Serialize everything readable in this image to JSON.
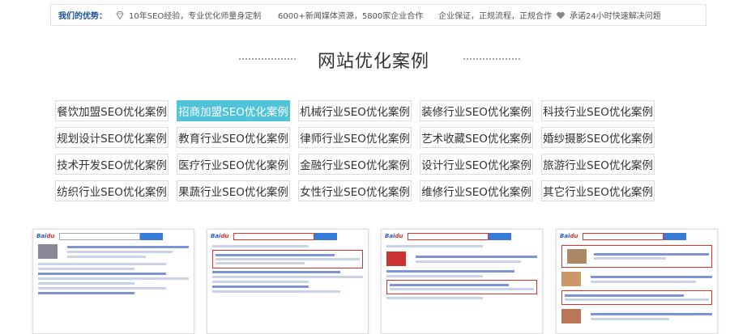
{
  "advantages": {
    "title": "我们的优势：",
    "items": [
      {
        "icon": "diamond-icon",
        "text": "10年SEO经验，专业优化师量身定制"
      },
      {
        "icon": "",
        "text": "6000+新闻媒体资源，5800家企业合作"
      },
      {
        "icon": "",
        "text": "企业保证，正规流程，正规合作"
      },
      {
        "icon": "heart-icon",
        "text": "承诺24小时快速解决问题"
      }
    ]
  },
  "section": {
    "title": "网站优化案例"
  },
  "categories": [
    "餐饮加盟SEO优化案例",
    "招商加盟SEO优化案例",
    "机械行业SEO优化案例",
    "装修行业SEO优化案例",
    "科技行业SEO优化案例",
    "规划设计SEO优化案例",
    "教育行业SEO优化案例",
    "律师行业SEO优化案例",
    "艺术收藏SEO优化案例",
    "婚纱摄影SEO优化案例",
    "技术开发SEO优化案例",
    "医疗行业SEO优化案例",
    "金融行业SEO优化案例",
    "设计行业SEO优化案例",
    "旅游行业SEO优化案例",
    "纺织行业SEO优化案例",
    "果蔬行业SEO优化案例",
    "女性行业SEO优化案例",
    "维修行业SEO优化案例",
    "其它行业SEO优化案例"
  ],
  "active_category_index": 1,
  "colors": {
    "accent": "#4fc2dc",
    "advantage_title": "#1b4f9a"
  }
}
